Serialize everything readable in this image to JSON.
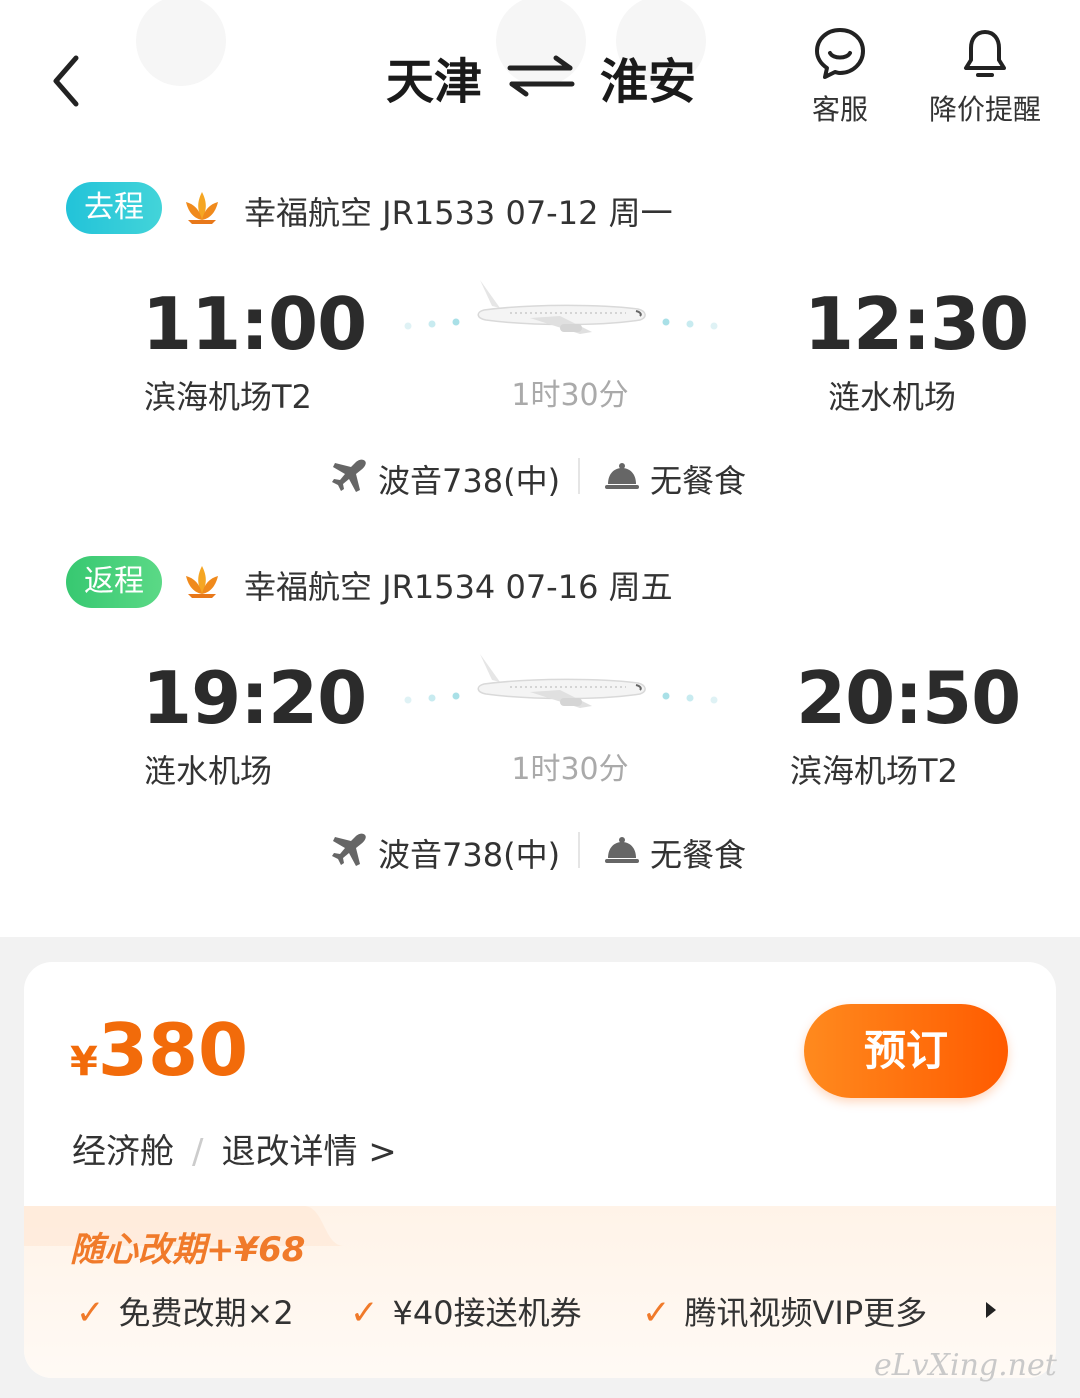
{
  "header": {
    "from_city": "天津",
    "to_city": "淮安",
    "service_label": "客服",
    "price_alert_label": "降价提醒"
  },
  "outbound": {
    "tag": "去程",
    "title": "幸福航空 JR1533  07-12 周一",
    "dep_time": "11:00",
    "dep_airport": "滨海机场T2",
    "duration": "1时30分",
    "arr_time": "12:30",
    "arr_airport": "涟水机场",
    "aircraft": "波音738(中)",
    "meal": "无餐食"
  },
  "return": {
    "tag": "返程",
    "title": "幸福航空 JR1534  07-16 周五",
    "dep_time": "19:20",
    "dep_airport": "涟水机场",
    "duration": "1时30分",
    "arr_time": "20:50",
    "arr_airport": "滨海机场T2",
    "aircraft": "波音738(中)",
    "meal": "无餐食"
  },
  "booking": {
    "currency": "¥",
    "price": "380",
    "book_label": "预订",
    "cabin": "经济舱",
    "slash": "/",
    "refund_link": "退改详情 >"
  },
  "promo": {
    "title": "随心改期+¥68",
    "perks": [
      "免费改期×2",
      "¥40接送机券",
      "腾讯视频VIP更多"
    ]
  },
  "watermark": "eLvXing.net",
  "colors": {
    "accent_orange": "#f26b0a",
    "outbound_tag": "#22c3d9",
    "return_tag": "#37c871"
  }
}
